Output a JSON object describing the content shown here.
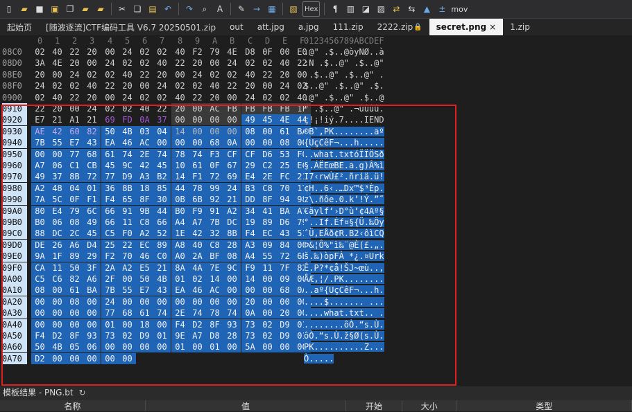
{
  "toolbar": {
    "icons": [
      "new-file",
      "open-folder",
      "save",
      "save-all",
      "copy-doc",
      "open-folder-2",
      "folder-tree",
      "cut",
      "copy",
      "paste",
      "undo",
      "redo",
      "find",
      "replace",
      "find-mark",
      "goto",
      "template-a",
      "template-b",
      "hex",
      "paragraph",
      "columns",
      "mark",
      "paste-special",
      "export",
      "swap",
      "chart",
      "calc",
      "mov"
    ],
    "hex_label": "Hex",
    "mov_label": "mov"
  },
  "tabs": [
    {
      "label": "起始页",
      "active": false
    },
    {
      "label": "[随波逐流]CTF编码工具 V6.7 20250501.zip",
      "active": false
    },
    {
      "label": "out",
      "active": false
    },
    {
      "label": "att.jpg",
      "active": false
    },
    {
      "label": "a.jpg",
      "active": false
    },
    {
      "label": "111.zip",
      "active": false
    },
    {
      "label": "2222.zip",
      "active": false,
      "locked": true
    },
    {
      "label": "secret.png",
      "active": true,
      "close": "×"
    },
    {
      "label": "1.zip",
      "active": false
    }
  ],
  "hex_header": {
    "columns": [
      "0",
      "1",
      "2",
      "3",
      "4",
      "5",
      "6",
      "7",
      "8",
      "9",
      "A",
      "B",
      "C",
      "D",
      "E",
      "F"
    ],
    "ascii": "0123456789ABCDEF"
  },
  "rows": [
    {
      "addr": "08C0",
      "bytes": [
        "02",
        "40",
        "22",
        "20",
        "00",
        "24",
        "02",
        "02",
        "40",
        "F2",
        "79",
        "4E",
        "D8",
        "0F",
        "00",
        "E0"
      ],
      "ascii": ".@\" .$..@òyNØ..à",
      "sel": []
    },
    {
      "addr": "08D0",
      "bytes": [
        "3A",
        "4E",
        "20",
        "00",
        "24",
        "02",
        "02",
        "40",
        "22",
        "20",
        "00",
        "24",
        "02",
        "02",
        "40",
        "22"
      ],
      "ascii": ":N .$..@\" .$..@\"",
      "sel": []
    },
    {
      "addr": "08E0",
      "bytes": [
        "20",
        "00",
        "24",
        "02",
        "02",
        "40",
        "22",
        "20",
        "00",
        "24",
        "02",
        "02",
        "40",
        "22",
        "20",
        "00"
      ],
      "ascii": " .$..@\" .$..@\" .",
      "sel": []
    },
    {
      "addr": "08F0",
      "bytes": [
        "24",
        "02",
        "02",
        "40",
        "22",
        "20",
        "00",
        "24",
        "02",
        "02",
        "40",
        "22",
        "20",
        "00",
        "24",
        "02"
      ],
      "ascii": "$..@\" .$..@\" .$.",
      "sel": []
    },
    {
      "addr": "0900",
      "bytes": [
        "02",
        "40",
        "22",
        "20",
        "00",
        "24",
        "02",
        "02",
        "40",
        "22",
        "20",
        "00",
        "24",
        "02",
        "02",
        "40"
      ],
      "ascii": ".@\" .$..@\" .$..@",
      "sel": []
    },
    {
      "addr": "0910",
      "bytes": [
        "22",
        "20",
        "00",
        "24",
        "02",
        "02",
        "40",
        "22",
        "20",
        "00",
        "AC",
        "FB",
        "FB",
        "FB",
        "FB",
        "1F"
      ],
      "ascii": "\" .$..@\" .¬ûûûû.",
      "sel": []
    },
    {
      "addr": "0920",
      "bytes": [
        "E7",
        "21",
        "A1",
        "21",
        "69",
        "FD",
        "0A",
        "37",
        "00",
        "00",
        "00",
        "00",
        "49",
        "45",
        "4E",
        "44"
      ],
      "ascii": "ç!¡!iý.7....IEND",
      "sel": []
    },
    {
      "addr": "0930",
      "bytes": [
        "AE",
        "42",
        "60",
        "82",
        "50",
        "4B",
        "03",
        "04",
        "14",
        "00",
        "00",
        "00",
        "08",
        "00",
        "61",
        "BA"
      ],
      "ascii": "®B`‚PK........aº",
      "sel": []
    },
    {
      "addr": "0940",
      "bytes": [
        "7B",
        "55",
        "E7",
        "43",
        "EA",
        "46",
        "AC",
        "00",
        "00",
        "00",
        "68",
        "0A",
        "00",
        "00",
        "08",
        "00"
      ],
      "ascii": "{UçCêF¬...h.....",
      "sel": []
    },
    {
      "addr": "0950",
      "bytes": [
        "00",
        "00",
        "77",
        "68",
        "61",
        "74",
        "2E",
        "74",
        "78",
        "74",
        "F3",
        "CF",
        "CF",
        "D6",
        "53",
        "F0"
      ],
      "ascii": "..what.txtóÏÏÖSð",
      "sel": []
    },
    {
      "addr": "0960",
      "bytes": [
        "A7",
        "06",
        "C1",
        "CB",
        "45",
        "9C",
        "42",
        "45",
        "10",
        "61",
        "0F",
        "67",
        "29",
        "C2",
        "25",
        "EC"
      ],
      "ascii": "§.ÁËEœBE.a.g)Â%ì",
      "sel": []
    },
    {
      "addr": "0970",
      "bytes": [
        "49",
        "37",
        "8B",
        "72",
        "77",
        "D9",
        "A3",
        "B2",
        "14",
        "F1",
        "72",
        "69",
        "E4",
        "2E",
        "FC",
        "21"
      ],
      "ascii": "I7‹rwÙ£².ñriä.ü!",
      "sel": []
    },
    {
      "addr": "0980",
      "bytes": [
        "A2",
        "48",
        "04",
        "01",
        "36",
        "8B",
        "18",
        "85",
        "44",
        "78",
        "99",
        "24",
        "B3",
        "C8",
        "70",
        "17"
      ],
      "ascii": "¢H..6‹.…Dx™$³Èp.",
      "sel": []
    },
    {
      "addr": "0990",
      "bytes": [
        "7A",
        "5C",
        "0F",
        "F1",
        "F4",
        "65",
        "8F",
        "30",
        "0B",
        "6B",
        "92",
        "21",
        "DD",
        "8F",
        "94",
        "98"
      ],
      "ascii": "z\\.ñôe.0.k’!Ý.”˜",
      "sel": []
    },
    {
      "addr": "09A0",
      "bytes": [
        "80",
        "E4",
        "79",
        "6C",
        "66",
        "91",
        "9B",
        "44",
        "B0",
        "F9",
        "91",
        "A2",
        "34",
        "41",
        "BA",
        "A7"
      ],
      "ascii": "€äylf‘›D°ù‘¢4Aº§",
      "sel": []
    },
    {
      "addr": "09B0",
      "bytes": [
        "B0",
        "06",
        "08",
        "49",
        "66",
        "11",
        "C8",
        "66",
        "A4",
        "A7",
        "7B",
        "DC",
        "19",
        "89",
        "D6",
        "79"
      ],
      "ascii": "°..If.Èf¤§{Ü.‰Öy",
      "sel": []
    },
    {
      "addr": "09C0",
      "bytes": [
        "88",
        "DC",
        "2C",
        "45",
        "C5",
        "F0",
        "A2",
        "52",
        "1E",
        "42",
        "32",
        "8B",
        "F4",
        "EC",
        "43",
        "51"
      ],
      "ascii": "ˆÜ,EÅð¢R.B2‹ôìCQ",
      "sel": []
    },
    {
      "addr": "09D0",
      "bytes": [
        "DE",
        "26",
        "A6",
        "D4",
        "25",
        "22",
        "EC",
        "89",
        "A8",
        "40",
        "C8",
        "28",
        "A3",
        "09",
        "84",
        "00"
      ],
      "ascii": "Þ&¦Ô%\"ì‰¨@È(£.„.",
      "sel": []
    },
    {
      "addr": "09E0",
      "bytes": [
        "9A",
        "1F",
        "89",
        "29",
        "F2",
        "70",
        "46",
        "C0",
        "A0",
        "2A",
        "BF",
        "08",
        "A4",
        "55",
        "72",
        "6B"
      ],
      "ascii": "š.‰)òpFÀ *¿.¤Urk",
      "sel": []
    },
    {
      "addr": "09F0",
      "bytes": [
        "CA",
        "11",
        "50",
        "3F",
        "2A",
        "A2",
        "E5",
        "21",
        "8A",
        "4A",
        "7E",
        "9C",
        "F9",
        "11",
        "7F",
        "82"
      ],
      "ascii": "Ê.P?*¢å!ŠJ~œù..‚",
      "sel": []
    },
    {
      "addr": "0A00",
      "bytes": [
        "C5",
        "C6",
        "82",
        "A6",
        "2F",
        "00",
        "50",
        "4B",
        "01",
        "02",
        "14",
        "00",
        "14",
        "00",
        "09",
        "00"
      ],
      "ascii": "ÅÆ‚¦/.PK........",
      "sel": []
    },
    {
      "addr": "0A10",
      "bytes": [
        "08",
        "00",
        "61",
        "BA",
        "7B",
        "55",
        "E7",
        "43",
        "EA",
        "46",
        "AC",
        "00",
        "00",
        "00",
        "68",
        "0A"
      ],
      "ascii": "..aº{UçCêF¬...h.",
      "sel": []
    },
    {
      "addr": "0A20",
      "bytes": [
        "00",
        "00",
        "08",
        "00",
        "24",
        "00",
        "00",
        "00",
        "00",
        "00",
        "00",
        "00",
        "20",
        "00",
        "00",
        "00"
      ],
      "ascii": "....$....... ...",
      "sel": []
    },
    {
      "addr": "0A30",
      "bytes": [
        "00",
        "00",
        "00",
        "00",
        "77",
        "68",
        "61",
        "74",
        "2E",
        "74",
        "78",
        "74",
        "0A",
        "00",
        "20",
        "00"
      ],
      "ascii": "....what.txt.. .",
      "sel": []
    },
    {
      "addr": "0A40",
      "bytes": [
        "00",
        "00",
        "00",
        "00",
        "01",
        "00",
        "18",
        "00",
        "F4",
        "D2",
        "8F",
        "93",
        "73",
        "02",
        "D9",
        "01"
      ],
      "ascii": "........ôÒ.“s.Ù.",
      "sel": []
    },
    {
      "addr": "0A50",
      "bytes": [
        "F4",
        "D2",
        "8F",
        "93",
        "73",
        "02",
        "D9",
        "01",
        "9E",
        "A7",
        "D8",
        "28",
        "73",
        "02",
        "D9",
        "01"
      ],
      "ascii": "ôÒ.“s.Ù.ž§Ø(s.Ù.",
      "sel": []
    },
    {
      "addr": "0A60",
      "bytes": [
        "50",
        "4B",
        "05",
        "06",
        "00",
        "00",
        "00",
        "00",
        "01",
        "00",
        "01",
        "00",
        "5A",
        "00",
        "00",
        "00"
      ],
      "ascii": "PK..........Z...",
      "sel": []
    },
    {
      "addr": "0A70",
      "bytes": [
        "D2",
        "00",
        "00",
        "00",
        "00",
        "00"
      ],
      "ascii": "Ò.....",
      "sel": []
    }
  ],
  "bottom": {
    "title": "模板结果 - PNG.bt",
    "refresh_icon": "refresh-icon",
    "columns": [
      "名称",
      "值",
      "开始",
      "大小",
      "类型"
    ]
  },
  "colors": {
    "selection": "#1f64b5",
    "highlight_box": "#e02020"
  }
}
